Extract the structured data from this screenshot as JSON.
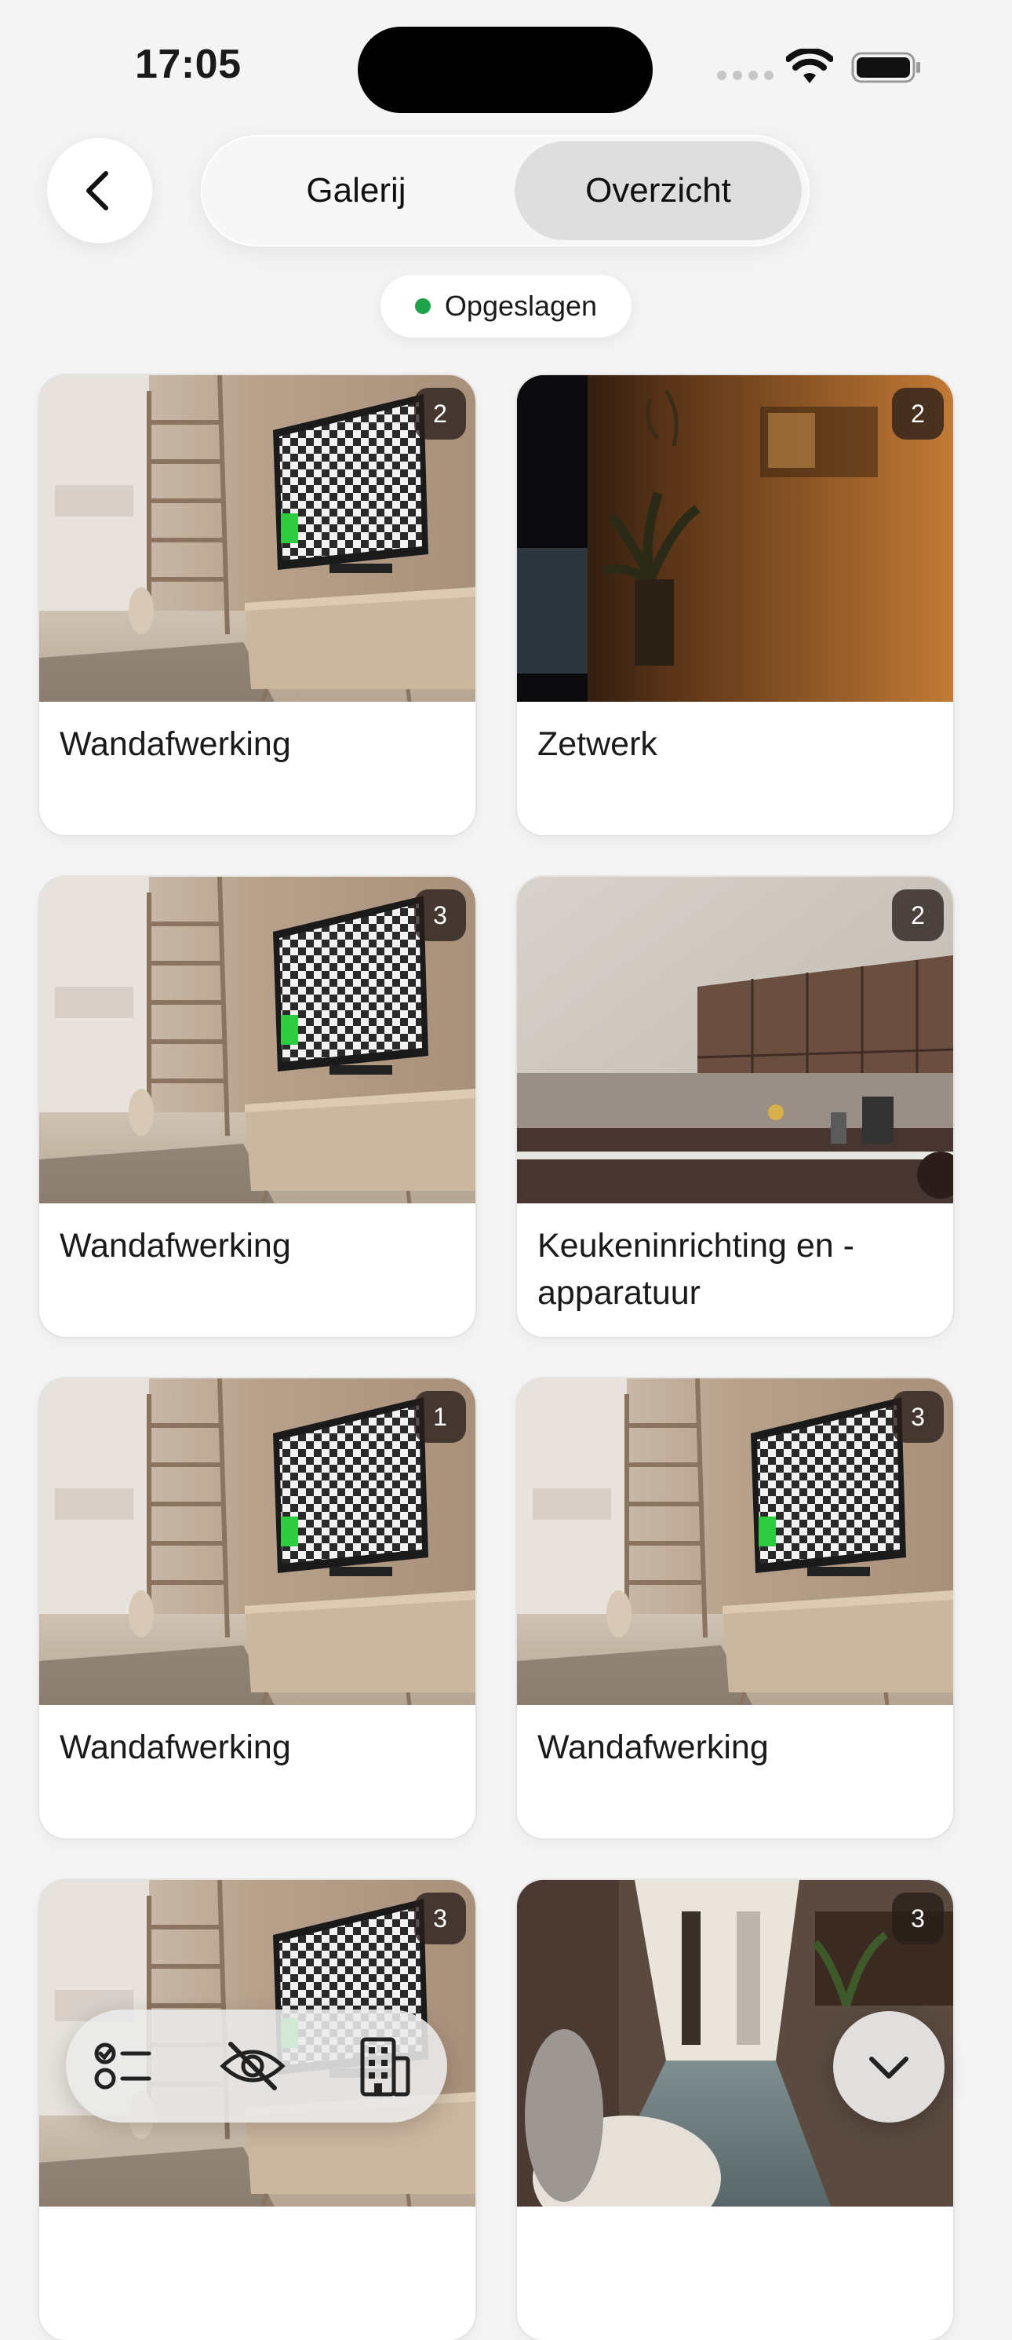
{
  "status": {
    "time": "17:05"
  },
  "header": {
    "tabs": [
      {
        "label": "Galerij",
        "selected": false
      },
      {
        "label": "Overzicht",
        "selected": true
      }
    ],
    "save_status": "Opgeslagen",
    "save_status_color": "#1fa34a"
  },
  "cards": [
    {
      "title": "Wandafwerking",
      "count": "2",
      "image": "living-room-tv"
    },
    {
      "title": "Zetwerk",
      "count": "2",
      "image": "dark-wall-plant"
    },
    {
      "title": "Wandafwerking",
      "count": "3",
      "image": "living-room-tv"
    },
    {
      "title": "Keukeninrichting en -apparatuur",
      "count": "2",
      "image": "kitchen"
    },
    {
      "title": "Wandafwerking",
      "count": "1",
      "image": "living-room-tv"
    },
    {
      "title": "Wandafwerking",
      "count": "3",
      "image": "living-room-tv"
    },
    {
      "title": "",
      "count": "3",
      "image": "living-room-tv"
    },
    {
      "title": "",
      "count": "3",
      "image": "hallway"
    }
  ],
  "toolbar": {
    "icons": [
      "checklist-icon",
      "eye-slash-icon",
      "building-icon"
    ],
    "scroll_button_icon": "chevron-down-icon"
  }
}
